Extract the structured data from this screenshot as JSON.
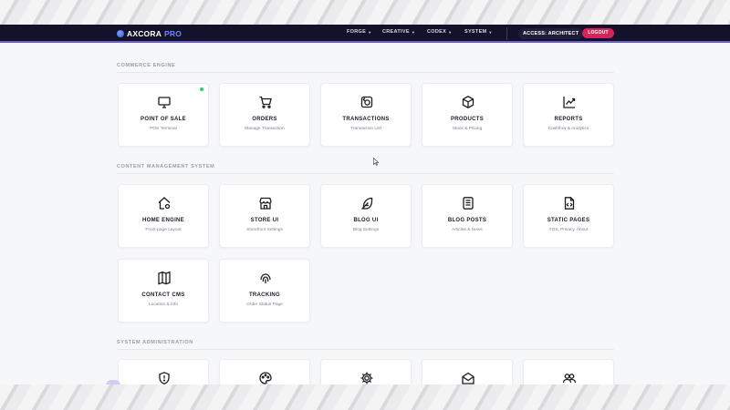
{
  "colors": {
    "topbar_bg": "#12132b",
    "accent": "#6f86ff",
    "logout": "#d4245a",
    "status_online": "#2ecc71",
    "page_bg": "#f6f7f9"
  },
  "brand": {
    "name": "AXCORA",
    "suffix": "PRO",
    "logo_icon": "brand-dot-icon"
  },
  "nav": {
    "forge": "FORGE",
    "creative": "CREATIVE",
    "codex": "CODEX",
    "system": "SYSTEM"
  },
  "access_badge": "ACCESS: ARCHITECT",
  "logout_label": "LOGOUT",
  "sections": {
    "commerce": {
      "title": "COMMERCE ENGINE",
      "cards": [
        {
          "title": "POINT OF SALE",
          "subtitle": "POS Terminal",
          "icon": "monitor-icon"
        },
        {
          "title": "ORDERS",
          "subtitle": "Manage Transaction",
          "icon": "cart-icon"
        },
        {
          "title": "TRANSACTIONS",
          "subtitle": "Transaction List",
          "icon": "money-exchange-icon"
        },
        {
          "title": "PRODUCTS",
          "subtitle": "Stock & Pricing",
          "icon": "box-icon"
        },
        {
          "title": "REPORTS",
          "subtitle": "Cashflow & Analytics",
          "icon": "trend-chart-icon"
        }
      ]
    },
    "cms": {
      "title": "CONTENT MANAGEMENT SYSTEM",
      "cards": [
        {
          "title": "HOME ENGINE",
          "subtitle": "Front-page Layout",
          "icon": "home-gear-icon"
        },
        {
          "title": "STORE UI",
          "subtitle": "Storefront Settings",
          "icon": "store-icon"
        },
        {
          "title": "BLOG UI",
          "subtitle": "Blog Settings",
          "icon": "feather-icon"
        },
        {
          "title": "BLOG POSTS",
          "subtitle": "Articles & News",
          "icon": "document-icon"
        },
        {
          "title": "STATIC PAGES",
          "subtitle": "TOS, Privacy, About",
          "icon": "code-file-icon"
        },
        {
          "title": "CONTACT CMS",
          "subtitle": "Location & Info",
          "icon": "map-icon"
        },
        {
          "title": "TRACKING",
          "subtitle": "Order Status Page",
          "icon": "fingerprint-icon"
        }
      ]
    },
    "admin": {
      "title": "SYSTEM ADMINISTRATION",
      "cards": [
        {
          "icon": "shield-icon"
        },
        {
          "icon": "palette-icon"
        },
        {
          "icon": "gear-icon"
        },
        {
          "icon": "mail-icon"
        },
        {
          "icon": "users-icon"
        }
      ]
    }
  }
}
